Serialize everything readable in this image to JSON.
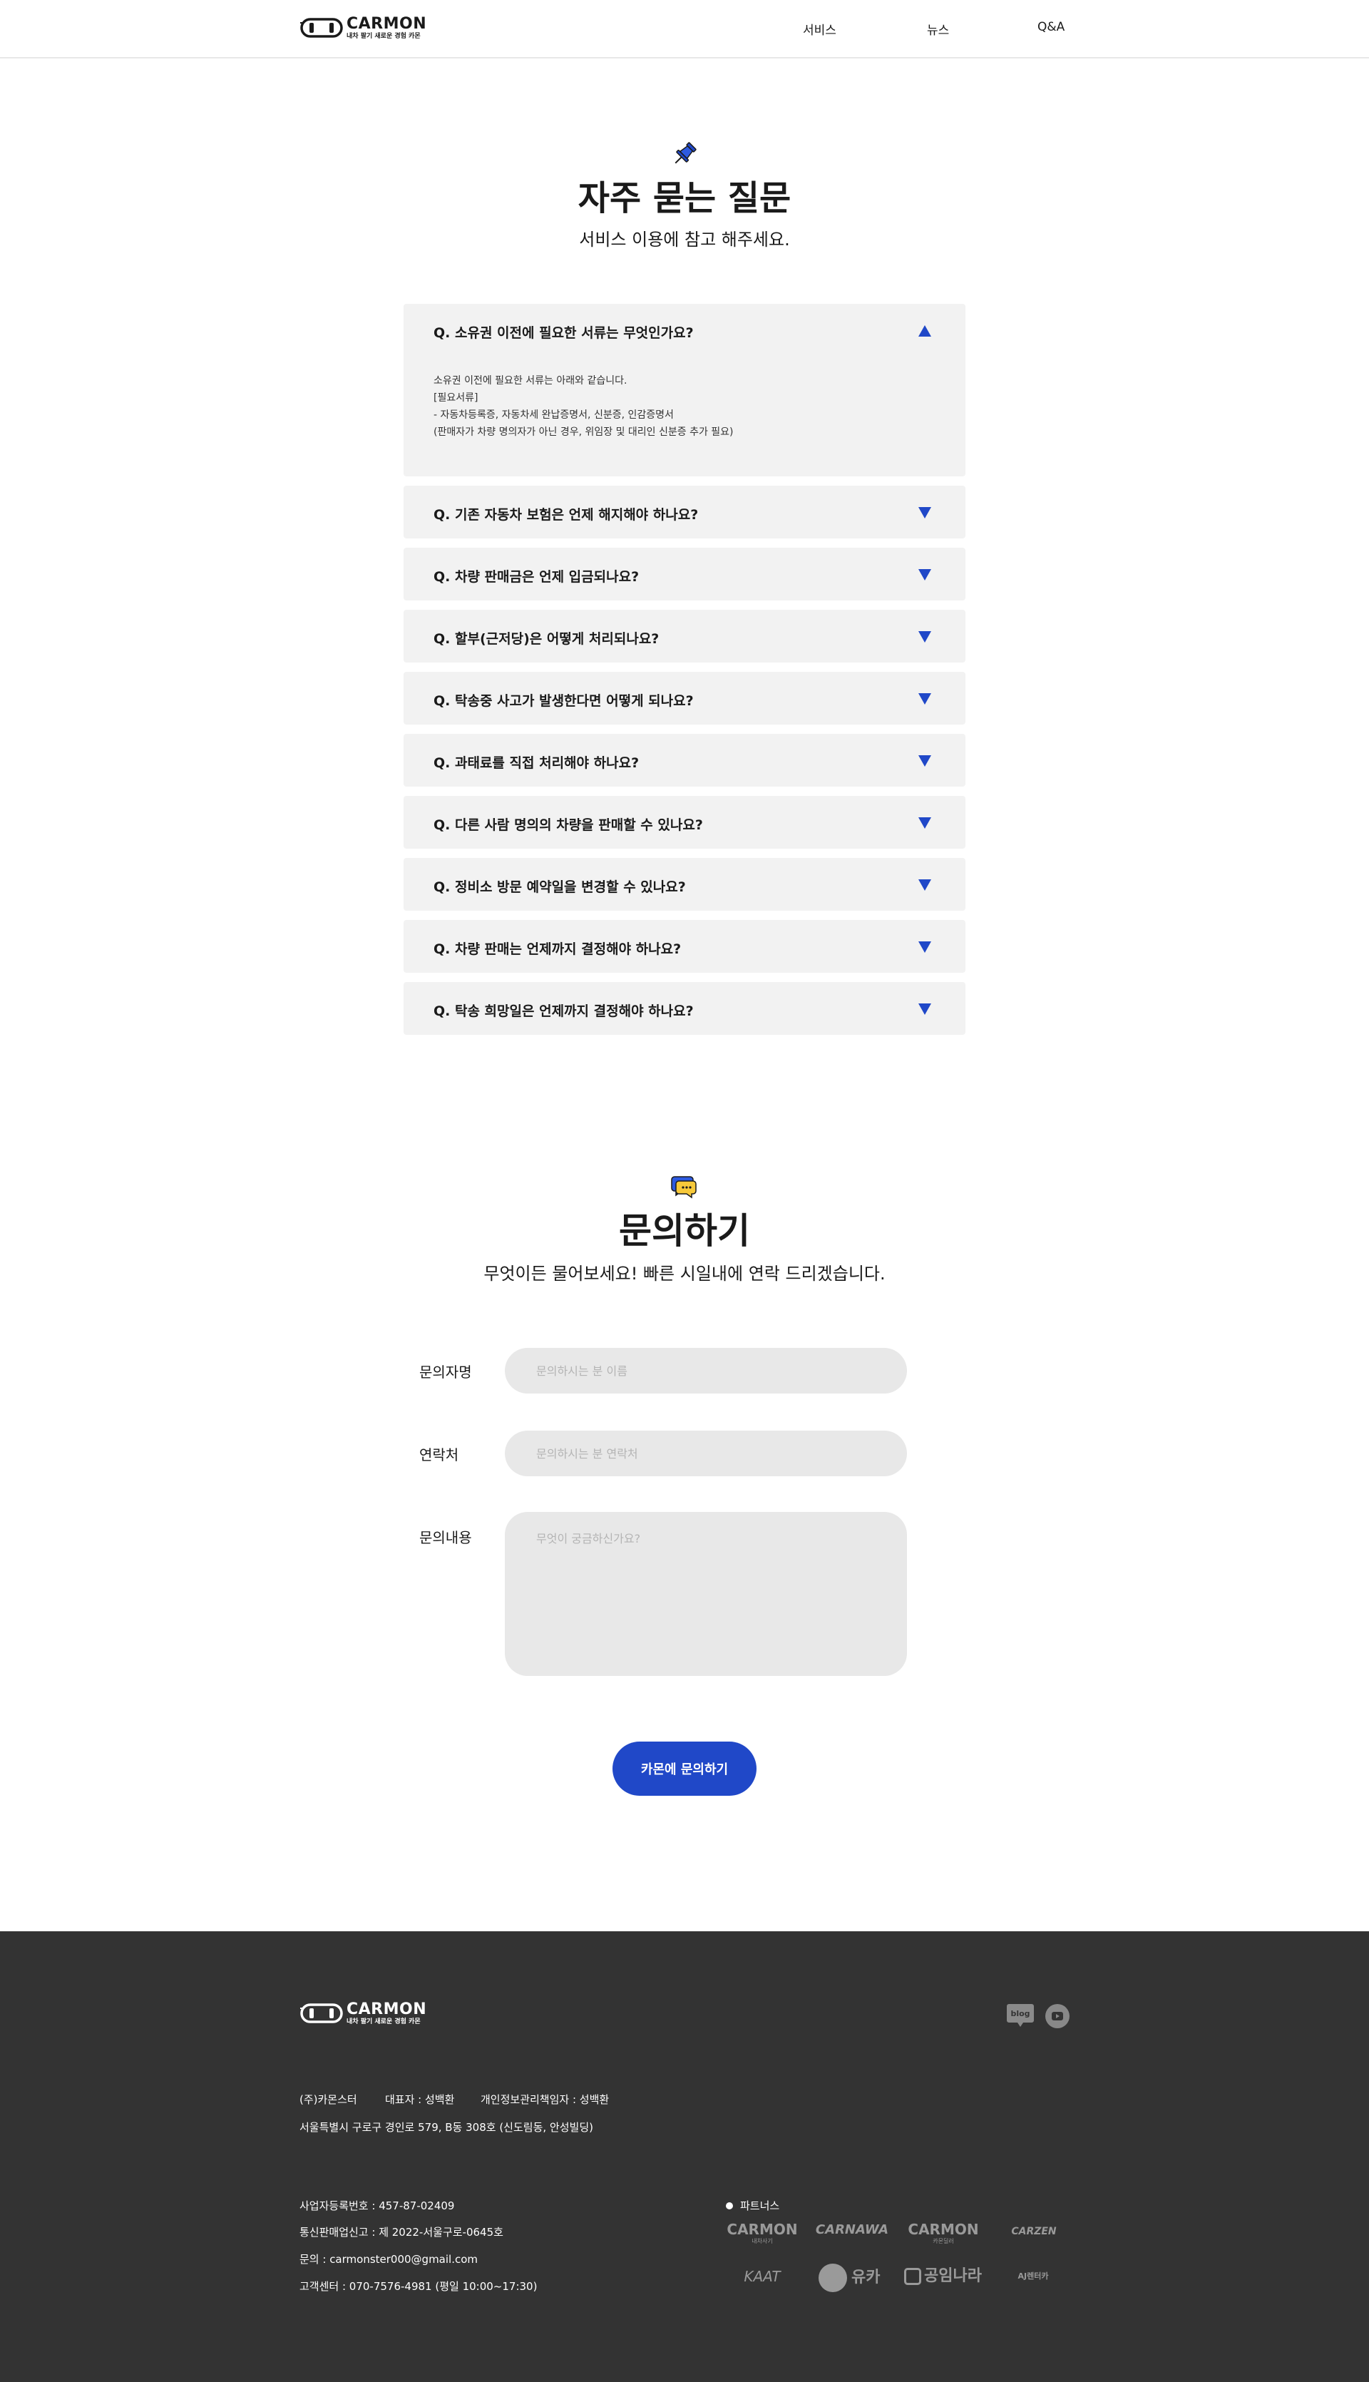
{
  "header": {
    "logo_text": "CARMON",
    "logo_tagline": "내차 팔기 새로운 경험 카몬",
    "nav": [
      {
        "label": "서비스"
      },
      {
        "label": "뉴스"
      },
      {
        "label": "Q&A"
      }
    ]
  },
  "faq": {
    "icon": "pushpin-icon",
    "title": "자주 묻는 질문",
    "subtitle": "서비스 이용에 참고 해주세요.",
    "items": [
      {
        "question": "Q. 소유권 이전에 필요한 서류는 무엇인가요?",
        "open": true,
        "answer": [
          "소유권 이전에 필요한 서류는 아래와 같습니다.",
          "[필요서류]",
          "- 자동차등록증, 자동차세 완납증명서, 신분증, 인감증명서",
          "(판매자가 차량 명의자가 아닌 경우, 위임장 및 대리인 신분증 추가 필요)"
        ]
      },
      {
        "question": "Q. 기존 자동차 보험은 언제 해지해야 하나요?",
        "open": false
      },
      {
        "question": "Q. 차량 판매금은 언제 입금되나요?",
        "open": false
      },
      {
        "question": "Q. 할부(근저당)은 어떻게 처리되나요?",
        "open": false
      },
      {
        "question": "Q. 탁송중 사고가 발생한다면 어떻게 되나요?",
        "open": false
      },
      {
        "question": "Q. 과태료를 직접 처리해야 하나요?",
        "open": false
      },
      {
        "question": "Q. 다른 사람 명의의 차량을 판매할 수 있나요?",
        "open": false
      },
      {
        "question": "Q. 정비소 방문 예약일을 변경할 수 있나요?",
        "open": false
      },
      {
        "question": "Q. 차량 판매는 언제까지 결정해야 하나요?",
        "open": false
      },
      {
        "question": "Q. 탁송 희망일은 언제까지 결정해야 하나요?",
        "open": false
      }
    ]
  },
  "inquiry": {
    "icon": "speech-bubble-icon",
    "title": "문의하기",
    "subtitle": "무엇이든 물어보세요! 빠른 시일내에 연락 드리겠습니다.",
    "fields": {
      "name_label": "문의자명",
      "name_placeholder": "문의하시는 분 이름",
      "contact_label": "연락처",
      "contact_placeholder": "문의하시는 분 연락처",
      "content_label": "문의내용",
      "content_placeholder": "무엇이 궁금하신가요?"
    },
    "submit_label": "카몬에 문의하기"
  },
  "footer": {
    "logo_text": "CARMON",
    "logo_tagline": "내차 팔기 새로운 경험 카몬",
    "company": "(주)카몬스터",
    "ceo": "대표자 : 성백환",
    "privacy_officer": "개인정보관리책임자 : 성백환",
    "address": "서울특별시 구로구 경인로 579, B동 308호 (신도림동, 안성빌딩)",
    "business_no": "사업자등록번호 : 457-87-02409",
    "ecommerce_no": "통신판매업신고 : 제 2022-서울구로-0645호",
    "email": "문의 : carmonster000@gmail.com",
    "cs_center": "고객센터 : 070-7576-4981 (평일 10:00~17:30)",
    "partners_title": "파트너스",
    "partners": [
      {
        "name": "CARMON",
        "sub": "내차사기"
      },
      {
        "name": "CARNAWA",
        "sub": ""
      },
      {
        "name": "CARMON",
        "sub": "카몬딜러"
      },
      {
        "name": "CARZEN",
        "sub": ""
      },
      {
        "name": "KAAT",
        "sub": ""
      },
      {
        "name": "유카",
        "sub": ""
      },
      {
        "name": "공임나라",
        "sub": ""
      },
      {
        "name": "AJ렌터카",
        "sub": ""
      }
    ],
    "blog_label": "blog",
    "social_icons": [
      "blog-icon",
      "youtube-icon"
    ]
  },
  "colors": {
    "accent": "#2048c8",
    "faq_bg": "#f2f2f2",
    "input_bg": "#e8e8e8",
    "footer_bg": "#333333"
  }
}
